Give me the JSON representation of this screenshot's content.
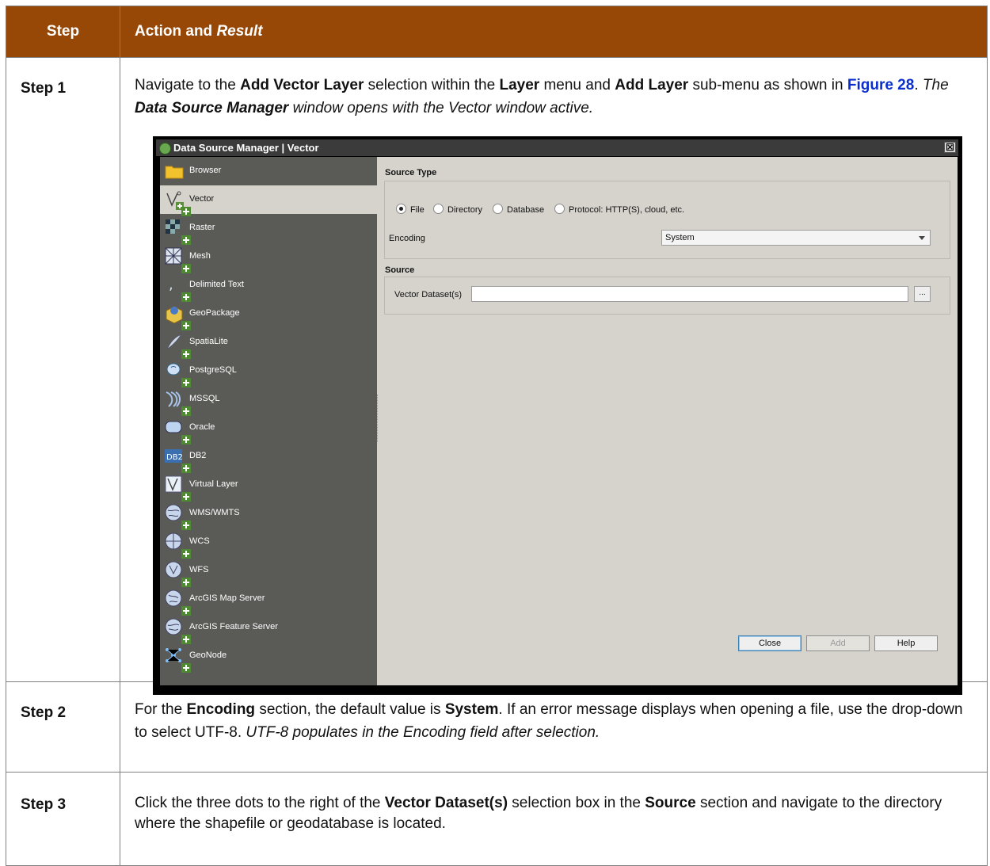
{
  "table": {
    "header_step": "Step",
    "header_action": "Action and ",
    "header_result": "Result"
  },
  "step1": {
    "label": "Step 1",
    "t1": "Navigate to the ",
    "b1": "Add Vector Layer",
    "t2": " selection within the ",
    "b2": "Layer",
    "t3": " menu and ",
    "b3": "Add Layer",
    "t4": " sub-menu as shown in ",
    "link": "Figure 28",
    "t5": ". ",
    "i1": "The ",
    "bi1": "Data Source Manager",
    "i2": " window opens with the Vector window active."
  },
  "dialog": {
    "title": "Data Source Manager | Vector",
    "close_glyph": "☒",
    "sidebar": [
      {
        "label": "Browser",
        "icon": "folder-icon",
        "selected": false
      },
      {
        "label": "Vector",
        "icon": "vector-icon",
        "selected": true
      },
      {
        "label": "Raster",
        "icon": "raster-icon",
        "selected": false
      },
      {
        "label": "Mesh",
        "icon": "mesh-icon",
        "selected": false
      },
      {
        "label": "Delimited Text",
        "icon": "delimited-text-icon",
        "selected": false
      },
      {
        "label": "GeoPackage",
        "icon": "geopackage-icon",
        "selected": false
      },
      {
        "label": "SpatiaLite",
        "icon": "spatialite-icon",
        "selected": false
      },
      {
        "label": "PostgreSQL",
        "icon": "postgresql-icon",
        "selected": false
      },
      {
        "label": "MSSQL",
        "icon": "mssql-icon",
        "selected": false
      },
      {
        "label": "Oracle",
        "icon": "oracle-icon",
        "selected": false
      },
      {
        "label": "DB2",
        "icon": "db2-icon",
        "selected": false
      },
      {
        "label": "Virtual Layer",
        "icon": "virtual-layer-icon",
        "selected": false
      },
      {
        "label": "WMS/WMTS",
        "icon": "wms-icon",
        "selected": false
      },
      {
        "label": "WCS",
        "icon": "wcs-icon",
        "selected": false
      },
      {
        "label": "WFS",
        "icon": "wfs-icon",
        "selected": false
      },
      {
        "label": "ArcGIS Map Server",
        "icon": "arcgis-map-icon",
        "selected": false
      },
      {
        "label": "ArcGIS Feature Server",
        "icon": "arcgis-feature-icon",
        "selected": false
      },
      {
        "label": "GeoNode",
        "icon": "geonode-icon",
        "selected": false
      }
    ],
    "source_type_title": "Source Type",
    "radio_file": "File",
    "radio_directory": "Directory",
    "radio_database": "Database",
    "radio_protocol": "Protocol: HTTP(S), cloud, etc.",
    "encoding_label": "Encoding",
    "encoding_value": "System",
    "source_title": "Source",
    "dataset_label": "Vector Dataset(s)",
    "dataset_value": "",
    "browse_label": "...",
    "btn_close": "Close",
    "btn_add": "Add",
    "btn_help": "Help"
  },
  "step2": {
    "label": "Step 2",
    "t1": "For the ",
    "b1": "Encoding",
    "t2": " section, the default value is ",
    "b2": "System",
    "t3": ". If an error message displays when opening a file, use the drop-down to select UTF-8. ",
    "i1": "UTF-8 populates in the Encoding field after selection."
  },
  "step3": {
    "label": "Step 3",
    "t1": "Click the three dots to the right of the ",
    "b1": "Vector Dataset(s)",
    "t2": " selection box in the ",
    "b2": "Source",
    "t3": " section and navigate to the directory where the shapefile or geodatabase is located."
  },
  "colors": {
    "header_bg": "#974806",
    "link": "#0b2fcf",
    "sidebar_bg": "#5a5a57",
    "panel_bg": "#d6d3cd"
  }
}
